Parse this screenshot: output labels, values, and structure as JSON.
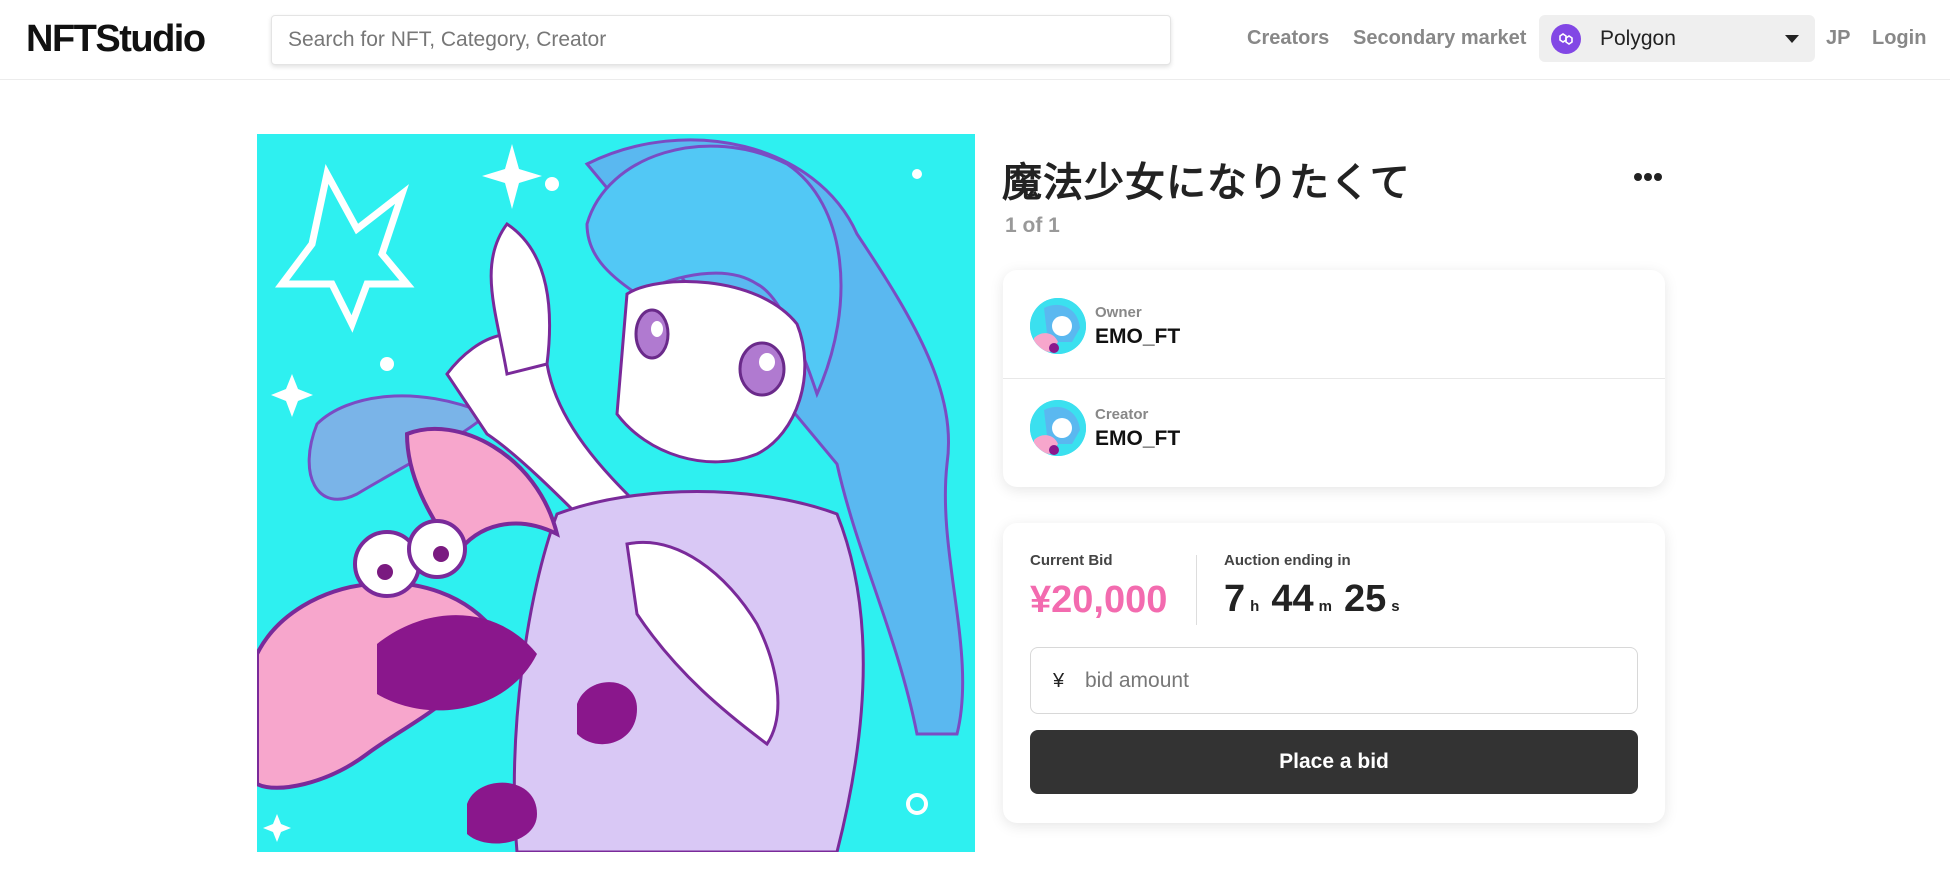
{
  "header": {
    "logo": "NFTStudio",
    "search_placeholder": "Search for NFT, Category, Creator",
    "nav": {
      "creators": "Creators",
      "secondary_market": "Secondary market",
      "language": "JP",
      "login": "Login"
    },
    "network": {
      "selected": "Polygon",
      "icon": "polygon-logo-icon",
      "icon_color": "#8247e5"
    }
  },
  "item": {
    "title": "魔法少女になりたくて",
    "edition": "1 of 1",
    "menu_icon": "more-dots-icon"
  },
  "people": {
    "owner": {
      "role": "Owner",
      "name": "EMO_FT"
    },
    "creator": {
      "role": "Creator",
      "name": "EMO_FT"
    }
  },
  "auction": {
    "current_bid_label": "Current Bid",
    "current_bid": "¥20,000",
    "ending_label": "Auction ending in",
    "timer": {
      "hours": "7",
      "hours_unit": "h",
      "minutes": "44",
      "minutes_unit": "m",
      "seconds": "25",
      "seconds_unit": "s"
    },
    "currency_symbol": "¥",
    "bid_placeholder": "bid amount",
    "button_label": "Place a bid"
  },
  "colors": {
    "accent_pink": "#f36baf",
    "button_dark": "#333333",
    "artwork_bg": "#2ef0f0"
  }
}
